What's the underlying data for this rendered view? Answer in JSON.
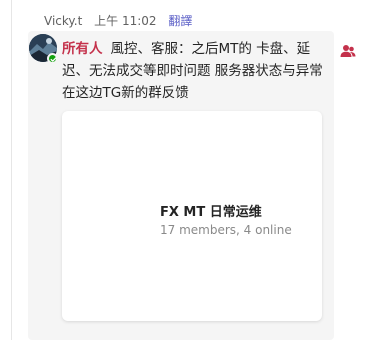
{
  "message": {
    "sender": "Vicky.t",
    "time": "上午 11:02",
    "translate_label": "翻譯",
    "mention": "所有人",
    "body": "風控、客服：之后MT的  卡盘、延迟、无法成交等即时问题    服务器状态与异常 在这边TG新的群反馈"
  },
  "preview": {
    "group_name": "FX MT 日常运维",
    "group_stats": "17 members, 4 online"
  },
  "colors": {
    "mention": "#c4314b",
    "translate_link": "#5b5fc7",
    "presence_available": "#13a10e",
    "people_icon": "#c4314b"
  },
  "icons": {
    "presence": "available-check-icon",
    "people": "people-icon"
  }
}
